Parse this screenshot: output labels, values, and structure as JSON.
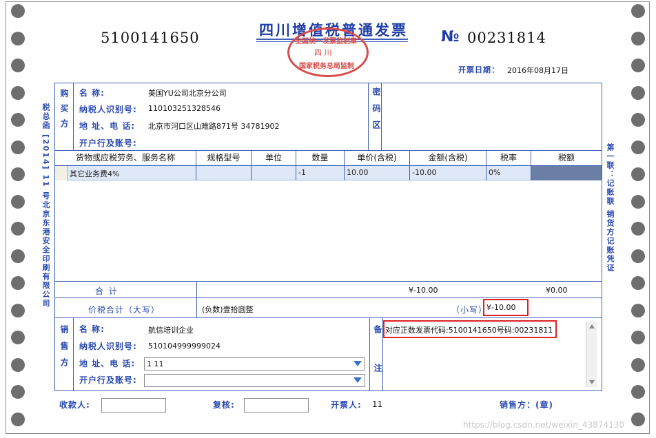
{
  "header": {
    "invoice_code": "5100141650",
    "title": "四川增值税普通发票",
    "number_symbol": "№",
    "invoice_number": "00231814",
    "issue_date_label": "开票日期：",
    "issue_date": "2016年08月17日",
    "stamp_text_top": "全国统一发票监制章",
    "stamp_text_mid": "四 川",
    "stamp_text_bottom": "国家税务总局监制"
  },
  "side_labels": {
    "left": "税总函 [2014] 11 号北京东港安全印刷有限公司",
    "right": "第一联：记账联 销货方记账凭证"
  },
  "buyer": {
    "section_label": "购买方",
    "name_label": "名        称:",
    "name": "美国YU公司北京分公司",
    "tax_id_label": "纳税人识别号:",
    "tax_id": "110103251328546",
    "address_label": "地 址、电 话:",
    "address": "北京市河口区山难路871号 34781902",
    "bank_label": "开户行及账号:",
    "bank": ""
  },
  "cipher": {
    "label": "密码区"
  },
  "items_table": {
    "columns": [
      "货物或应税劳务、服务名称",
      "规格型号",
      "单位",
      "数量",
      "单价(含税)",
      "金额(含税)",
      "税率",
      "税额"
    ],
    "rows": [
      [
        "其它业务费4%",
        "",
        "",
        "-1",
        "10.00",
        "-10.00",
        "0%",
        ""
      ]
    ]
  },
  "totals": {
    "label": "合        计",
    "amount": "¥-10.00",
    "tax": "¥0.00",
    "big_label": "价税合计（大写）",
    "big_value": "(负数)壹拾圆整",
    "small_label": "（小写）",
    "small_value": "¥-10.00"
  },
  "seller": {
    "section_label": "销售方",
    "name_label": "名        称:",
    "name": "航信培训企业",
    "tax_id_label": "纳税人识别号:",
    "tax_id": "510104999999024",
    "address_label": "地 址、电 话:",
    "address": "1 11",
    "bank_label": "开户行及账号:",
    "bank": ""
  },
  "remarks": {
    "label": "备注",
    "text": "对应正数发票代码:5100141650号码:00231811"
  },
  "footer": {
    "payee_label": "收款人:",
    "payee": "",
    "reviewer_label": "复核:",
    "reviewer": "",
    "drawer_label": "开票人:",
    "drawer": "11",
    "seller_label": "销售方：(章)"
  },
  "watermark": "https://blog.csdn.net/weixin_43874130",
  "colors": {
    "label_blue": "#2a4ab0",
    "frame_blue": "#3b5fb8",
    "stamp_red": "#d94b4b",
    "highlight_red": "#e02020",
    "selected_row": "#dfe8f6"
  }
}
